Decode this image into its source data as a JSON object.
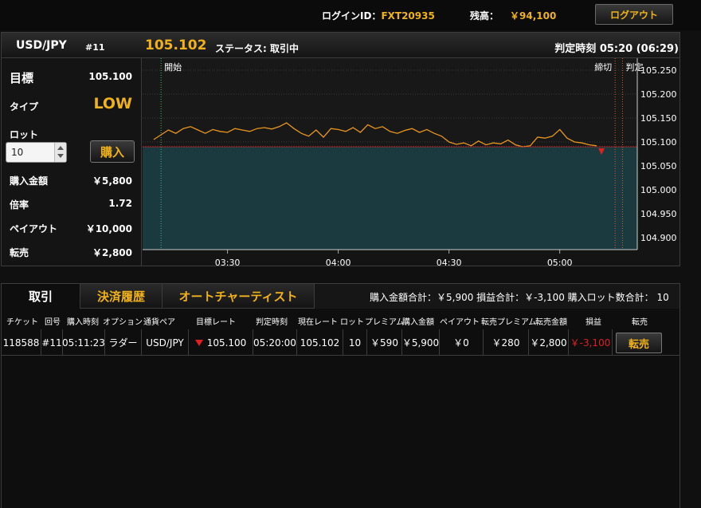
{
  "account": {
    "login_label": "ログインID：",
    "login_id": "FXT20935",
    "balance_label": "残高：",
    "balance": "￥94,100",
    "logout_label": "ログアウト"
  },
  "trade": {
    "pair": "USD/JPY",
    "round_no": "#11",
    "current_rate": "105.102",
    "status": "ステータス: 取引中",
    "judge_time": "判定時刻 05:20 (06:29)"
  },
  "info": {
    "target_label": "目標",
    "target_value": "105.100",
    "type_label": "タイプ",
    "type_value": "LOW",
    "lot_label": "ロット",
    "lot_value": "10",
    "buy_label": "購入",
    "amount_label": "購入金額",
    "amount_value": "￥5,800",
    "rate_label": "倍率",
    "rate_value": "1.72",
    "payout_label": "ペイアウト",
    "payout_value": "￥10,000",
    "resale_label": "転売",
    "resale_value": "￥2,800"
  },
  "chart_data": {
    "type": "line",
    "markers": {
      "start": "開始",
      "close": "締切",
      "judge": "判定"
    },
    "y_ticks": [
      "105.250",
      "105.200",
      "105.150",
      "105.100",
      "105.050",
      "105.000",
      "104.950",
      "104.900"
    ],
    "x_ticks": [
      "03:30",
      "04:00",
      "04:30",
      "05:00"
    ],
    "target_rate": 105.09,
    "series": [
      {
        "x": [
          "03:10",
          "03:12",
          "03:14",
          "03:16",
          "03:18",
          "03:20",
          "03:22",
          "03:24",
          "03:26",
          "03:28",
          "03:30",
          "03:32",
          "03:34",
          "03:36",
          "03:38",
          "03:40",
          "03:42",
          "03:44",
          "03:46",
          "03:48",
          "03:50",
          "03:52",
          "03:54",
          "03:56",
          "03:58",
          "04:00",
          "04:02",
          "04:04",
          "04:06",
          "04:08",
          "04:10",
          "04:12",
          "04:14",
          "04:16",
          "04:18",
          "04:20",
          "04:22",
          "04:24",
          "04:26",
          "04:28",
          "04:30",
          "04:32",
          "04:34",
          "04:36",
          "04:38",
          "04:40",
          "04:42",
          "04:44",
          "04:46",
          "04:48",
          "04:50",
          "04:52",
          "04:54",
          "04:56",
          "04:58",
          "05:00",
          "05:02",
          "05:04",
          "05:06",
          "05:08",
          "05:10"
        ],
        "y": [
          105.105,
          105.115,
          105.125,
          105.118,
          105.128,
          105.132,
          105.125,
          105.118,
          105.126,
          105.122,
          105.12,
          105.128,
          105.125,
          105.122,
          105.128,
          105.13,
          105.127,
          105.132,
          105.14,
          105.128,
          105.118,
          105.112,
          105.125,
          105.11,
          105.128,
          105.126,
          105.122,
          105.13,
          105.12,
          105.136,
          105.128,
          105.132,
          105.122,
          105.118,
          105.124,
          105.128,
          105.12,
          105.126,
          105.118,
          105.112,
          105.1,
          105.095,
          105.098,
          105.092,
          105.102,
          105.094,
          105.098,
          105.096,
          105.104,
          105.094,
          105.09,
          105.092,
          105.11,
          105.108,
          105.112,
          105.126,
          105.108,
          105.1,
          105.098,
          105.094,
          105.092
        ]
      }
    ]
  },
  "tabs": {
    "trades": "取引",
    "history": "決済履歴",
    "chartist": "オートチャーティスト"
  },
  "summary": "購入金額合計：￥5,900 損益合計：￥-3,100 購入ロット数合計： 10",
  "table": {
    "headers": [
      "チケット",
      "回号",
      "購入時刻",
      "オプション",
      "通貨ペア",
      "目標レート",
      "判定時刻",
      "現在レート",
      "ロット",
      "プレミアム",
      "購入金額",
      "ペイアウト",
      "転売プレミアム",
      "転売金額",
      "損益",
      "転売"
    ],
    "row": {
      "ticket": "118588",
      "round": "#11",
      "time": "05:11:23",
      "option": "ラダー",
      "pair": "USD/JPY",
      "target": "105.100",
      "judge_time": "05:20:00",
      "current": "105.102",
      "lot": "10",
      "premium": "￥590",
      "amount": "￥5,900",
      "payout": "￥0",
      "resale_premium": "￥280",
      "resale_amount": "￥2,800",
      "pnl": "￥-3,100",
      "resell_label": "転売"
    }
  },
  "colors": {
    "accent": "#f0b21a",
    "line": "#e8961e",
    "target_line": "#e02020",
    "below_fill": "#1b3a40",
    "negative": "#e02020"
  }
}
